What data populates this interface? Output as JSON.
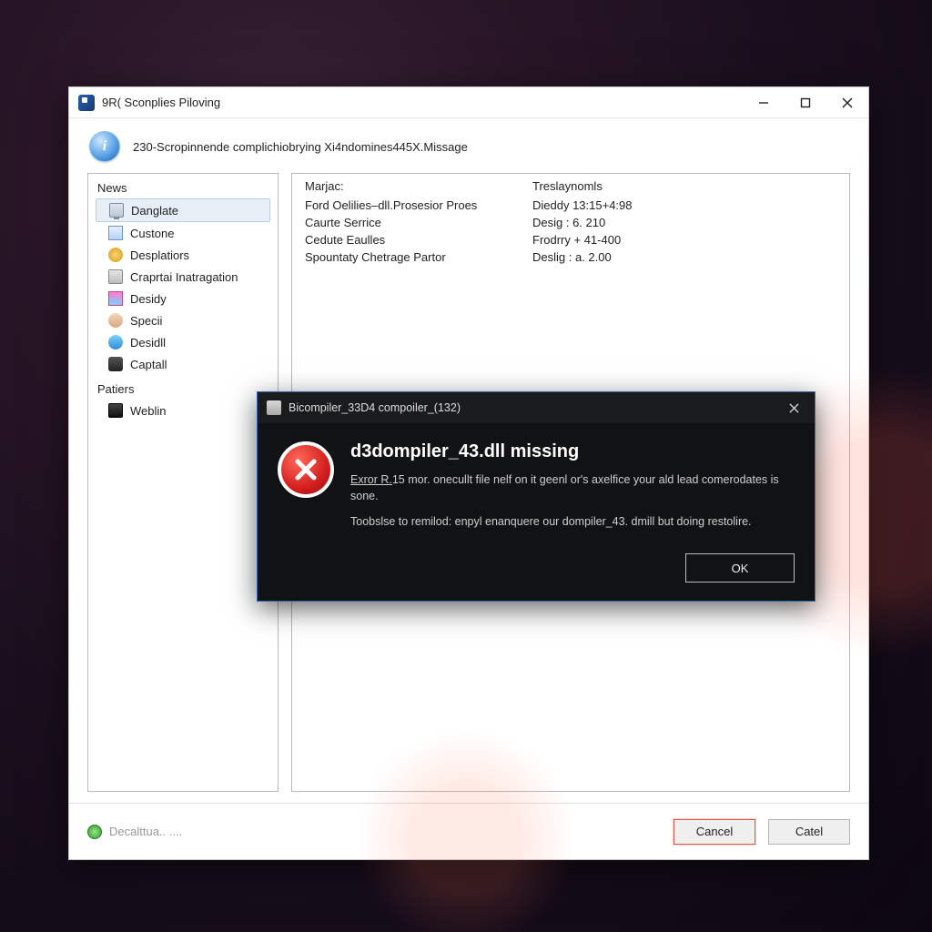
{
  "window": {
    "title": "9R( Sconplies Piloving"
  },
  "header": {
    "subtitle": "230-Scropinnende complichiobrying Xi4ndomines445X.Missage"
  },
  "sidebar": {
    "section1": "News",
    "items": [
      "Danglate",
      "Custone",
      "Desplatiors",
      "Craprtai Inatragation",
      "Desidy",
      "Specii",
      "Desidll",
      "Captall"
    ],
    "section2": "Patiers",
    "items2": [
      "Weblin"
    ]
  },
  "table": {
    "head": {
      "c1": "Marjac:",
      "c2": "Treslaynomls"
    },
    "rows": [
      {
        "c1": "Ford Oelilies–dll.Prosesior Proes",
        "c2": "Dieddy 13:15+4:98"
      },
      {
        "c1": "Caurte Serrice",
        "c2": "Desig : 6. 210"
      },
      {
        "c1": "Cedute Eaulles",
        "c2": "Frodrry + 41-400"
      },
      {
        "c1": "Spountaty Chetrage Partor",
        "c2": "Deslig : a. 2.00"
      }
    ]
  },
  "footer": {
    "status": "Decalttua.. ....",
    "cancel": "Cancel",
    "catel": "Catel"
  },
  "dialog": {
    "title": "Bicompiler_33D4 compoiler_(132)",
    "heading": "d3dompiler_43.dll missing",
    "p1a": "Exror R.",
    "p1b": "15 mor. onecullt file nelf on it geenl or's axelfice your ald lead comerodates is sone.",
    "p2": "Toobslse to remilod: enpyl enanquere our dompiler_43. dmill but doing restolire.",
    "ok": "OK"
  }
}
